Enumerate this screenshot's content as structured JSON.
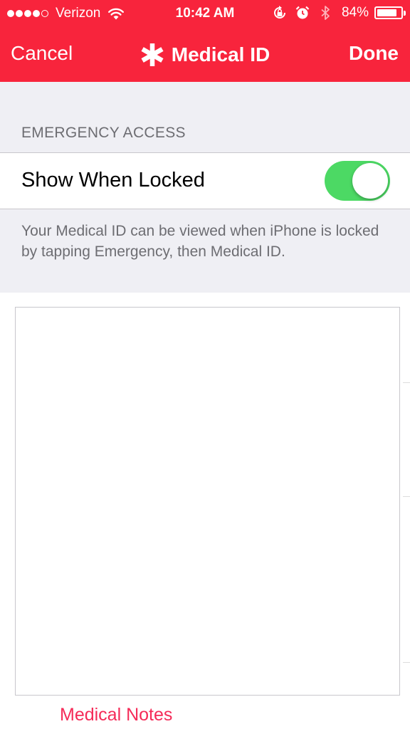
{
  "status_bar": {
    "carrier": "Verizon",
    "time": "10:42 AM",
    "battery_percent": "84%",
    "battery_level": 0.84,
    "signal_bars": 4,
    "signal_total": 5,
    "icons": [
      "wifi-icon",
      "rotation-lock-icon",
      "alarm-icon",
      "bluetooth-icon",
      "battery-icon"
    ]
  },
  "nav": {
    "cancel_label": "Cancel",
    "title": "Medical ID",
    "title_icon": "star-of-life-icon",
    "done_label": "Done"
  },
  "emergency_access": {
    "header": "EMERGENCY ACCESS",
    "show_when_locked_label": "Show When Locked",
    "show_when_locked_on": true,
    "footer_note": "Your Medical ID can be viewed when iPhone is locked by tapping Emergency, then Medical ID."
  },
  "notes": {
    "value": "",
    "label": "Medical Notes"
  },
  "colors": {
    "header_red": "#f8243c",
    "toggle_on_green": "#4cd964",
    "group_background": "#efeff4",
    "secondary_text": "#6d6d72",
    "notes_label_pink": "#f52b58"
  }
}
